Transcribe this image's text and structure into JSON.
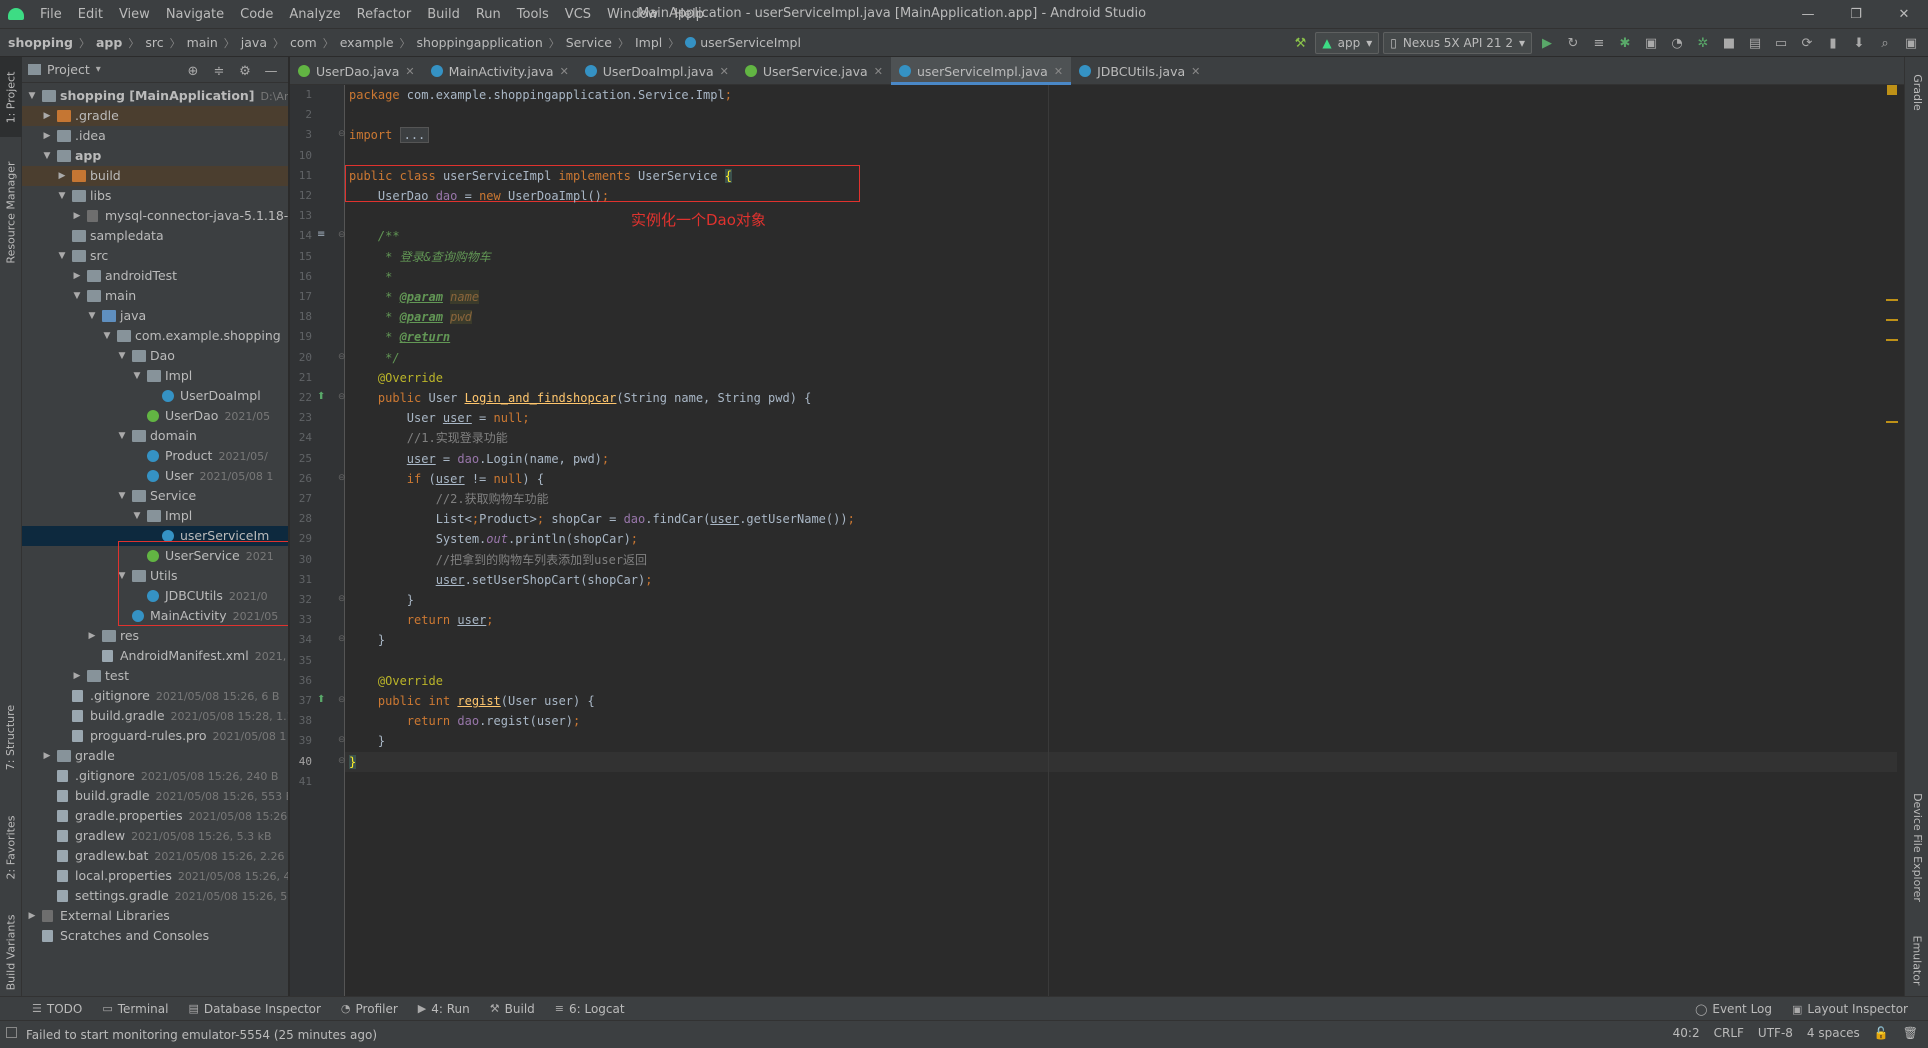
{
  "window": {
    "title": "MainApplication - userServiceImpl.java [MainApplication.app] - Android Studio",
    "menu": [
      "File",
      "Edit",
      "View",
      "Navigate",
      "Code",
      "Analyze",
      "Refactor",
      "Build",
      "Run",
      "Tools",
      "VCS",
      "Window",
      "Help"
    ]
  },
  "breadcrumbs": [
    "shopping",
    "app",
    "src",
    "main",
    "java",
    "com",
    "example",
    "shoppingapplication",
    "Service",
    "Impl",
    "userServiceImpl"
  ],
  "toolbar": {
    "config": "app",
    "device": "Nexus 5X API 21 2"
  },
  "side_tabs": {
    "project": "1: Project",
    "resource_manager": "Resource Manager",
    "structure": "7: Structure",
    "favorites": "2: Favorites",
    "build_variants": "Build Variants",
    "gradle": "Gradle",
    "device_file_explorer": "Device File Explorer",
    "emulator": "Emulator"
  },
  "project_panel": {
    "title": "Project",
    "tree": [
      {
        "label": "shopping [MainApplication]",
        "meta": "D:\\Andro",
        "depth": 0,
        "icon": "folder",
        "arrow": "open",
        "bold": true
      },
      {
        "label": ".gradle",
        "meta": "",
        "depth": 1,
        "icon": "folder-orange",
        "arrow": "closed",
        "hl": true
      },
      {
        "label": ".idea",
        "meta": "",
        "depth": 1,
        "icon": "folder",
        "arrow": "closed"
      },
      {
        "label": "app",
        "meta": "",
        "depth": 1,
        "icon": "folder",
        "arrow": "open",
        "bold": true
      },
      {
        "label": "build",
        "meta": "",
        "depth": 2,
        "icon": "folder-orange",
        "arrow": "closed",
        "hl": true
      },
      {
        "label": "libs",
        "meta": "",
        "depth": 2,
        "icon": "folder",
        "arrow": "open"
      },
      {
        "label": "mysql-connector-java-5.1.18-l",
        "meta": "",
        "depth": 3,
        "icon": "lib",
        "arrow": "closed"
      },
      {
        "label": "sampledata",
        "meta": "",
        "depth": 2,
        "icon": "folder",
        "arrow": "none"
      },
      {
        "label": "src",
        "meta": "",
        "depth": 2,
        "icon": "folder",
        "arrow": "open"
      },
      {
        "label": "androidTest",
        "meta": "",
        "depth": 3,
        "icon": "folder",
        "arrow": "closed"
      },
      {
        "label": "main",
        "meta": "",
        "depth": 3,
        "icon": "folder",
        "arrow": "open"
      },
      {
        "label": "java",
        "meta": "",
        "depth": 4,
        "icon": "folder-blue",
        "arrow": "open"
      },
      {
        "label": "com.example.shopping",
        "meta": "",
        "depth": 5,
        "icon": "pkg",
        "arrow": "open"
      },
      {
        "label": "Dao",
        "meta": "",
        "depth": 6,
        "icon": "pkg",
        "arrow": "open"
      },
      {
        "label": "Impl",
        "meta": "",
        "depth": 7,
        "icon": "pkg",
        "arrow": "open"
      },
      {
        "label": "UserDoaImpl",
        "meta": "",
        "depth": 8,
        "icon": "cls",
        "arrow": "none"
      },
      {
        "label": "UserDao",
        "meta": "2021/05",
        "depth": 7,
        "icon": "iface",
        "arrow": "none"
      },
      {
        "label": "domain",
        "meta": "",
        "depth": 6,
        "icon": "pkg",
        "arrow": "open"
      },
      {
        "label": "Product",
        "meta": "2021/05/",
        "depth": 7,
        "icon": "cls",
        "arrow": "none"
      },
      {
        "label": "User",
        "meta": "2021/05/08 1",
        "depth": 7,
        "icon": "cls",
        "arrow": "none"
      },
      {
        "label": "Service",
        "meta": "",
        "depth": 6,
        "icon": "pkg",
        "arrow": "open"
      },
      {
        "label": "Impl",
        "meta": "",
        "depth": 7,
        "icon": "pkg",
        "arrow": "open"
      },
      {
        "label": "userServiceIm",
        "meta": "",
        "depth": 8,
        "icon": "cls",
        "arrow": "none",
        "sel": true
      },
      {
        "label": "UserService",
        "meta": "2021",
        "depth": 7,
        "icon": "iface",
        "arrow": "none"
      },
      {
        "label": "Utils",
        "meta": "",
        "depth": 6,
        "icon": "pkg",
        "arrow": "open"
      },
      {
        "label": "JDBCUtils",
        "meta": "2021/0",
        "depth": 7,
        "icon": "cls",
        "arrow": "none"
      },
      {
        "label": "MainActivity",
        "meta": "2021/05",
        "depth": 6,
        "icon": "cls",
        "arrow": "none"
      },
      {
        "label": "res",
        "meta": "",
        "depth": 4,
        "icon": "folder",
        "arrow": "closed"
      },
      {
        "label": "AndroidManifest.xml",
        "meta": "2021,",
        "depth": 4,
        "icon": "file",
        "arrow": "none"
      },
      {
        "label": "test",
        "meta": "",
        "depth": 3,
        "icon": "folder",
        "arrow": "closed"
      },
      {
        "label": ".gitignore",
        "meta": "2021/05/08 15:26, 6 B",
        "depth": 2,
        "icon": "file",
        "arrow": "none"
      },
      {
        "label": "build.gradle",
        "meta": "2021/05/08 15:28, 1.1",
        "depth": 2,
        "icon": "file",
        "arrow": "none"
      },
      {
        "label": "proguard-rules.pro",
        "meta": "2021/05/08 1",
        "depth": 2,
        "icon": "file",
        "arrow": "none"
      },
      {
        "label": "gradle",
        "meta": "",
        "depth": 1,
        "icon": "folder",
        "arrow": "closed"
      },
      {
        "label": ".gitignore",
        "meta": "2021/05/08 15:26, 240 B",
        "depth": 1,
        "icon": "file",
        "arrow": "none"
      },
      {
        "label": "build.gradle",
        "meta": "2021/05/08 15:26, 553 B",
        "depth": 1,
        "icon": "file",
        "arrow": "none"
      },
      {
        "label": "gradle.properties",
        "meta": "2021/05/08 15:26, 1",
        "depth": 1,
        "icon": "file",
        "arrow": "none"
      },
      {
        "label": "gradlew",
        "meta": "2021/05/08 15:26, 5.3 kB",
        "depth": 1,
        "icon": "file",
        "arrow": "none"
      },
      {
        "label": "gradlew.bat",
        "meta": "2021/05/08 15:26, 2.26 kB",
        "depth": 1,
        "icon": "file",
        "arrow": "none"
      },
      {
        "label": "local.properties",
        "meta": "2021/05/08 15:26, 42",
        "depth": 1,
        "icon": "file",
        "arrow": "none"
      },
      {
        "label": "settings.gradle",
        "meta": "2021/05/08 15:26, 52 B",
        "depth": 1,
        "icon": "file",
        "arrow": "none"
      },
      {
        "label": "External Libraries",
        "meta": "",
        "depth": 0,
        "icon": "lib",
        "arrow": "closed"
      },
      {
        "label": "Scratches and Consoles",
        "meta": "",
        "depth": 0,
        "icon": "file",
        "arrow": "none"
      }
    ]
  },
  "editor_tabs": [
    {
      "label": "UserDao.java",
      "kind": "iface",
      "active": false
    },
    {
      "label": "MainActivity.java",
      "kind": "cls",
      "active": false
    },
    {
      "label": "UserDoaImpl.java",
      "kind": "cls",
      "active": false
    },
    {
      "label": "UserService.java",
      "kind": "iface",
      "active": false
    },
    {
      "label": "userServiceImpl.java",
      "kind": "cls",
      "active": true
    },
    {
      "label": "JDBCUtils.java",
      "kind": "cls",
      "active": false
    }
  ],
  "annotation_note": "实例化一个Dao对象",
  "code": {
    "line_numbers": [
      "1",
      "2",
      "3",
      "10",
      "11",
      "12",
      "13",
      "14",
      "15",
      "16",
      "17",
      "18",
      "19",
      "20",
      "21",
      "22",
      "23",
      "24",
      "25",
      "26",
      "27",
      "28",
      "29",
      "30",
      "31",
      "32",
      "33",
      "34",
      "35",
      "36",
      "37",
      "38",
      "39",
      "40",
      "41"
    ],
    "current_line": "40",
    "lines": [
      "package com.example.shoppingapplication.Service.Impl;",
      "",
      "import ...",
      "",
      "public class userServiceImpl implements UserService {",
      "    UserDao dao = new UserDoaImpl();",
      "",
      "    /**",
      "     * 登录&查询购物车",
      "     *",
      "     * @param name",
      "     * @param pwd",
      "     * @return",
      "     */",
      "    @Override",
      "    public User Login_and_findshopcar(String name, String pwd) {",
      "        User user = null;",
      "        //1.实现登录功能",
      "        user = dao.Login(name, pwd);",
      "        if (user != null) {",
      "            //2.获取购物车功能",
      "            List<Product> shopCar = dao.findCar(user.getUserName());",
      "            System.out.println(shopCar);",
      "            //把拿到的购物车列表添加到user返回",
      "            user.setUserShopCart(shopCar);",
      "        }",
      "        return user;",
      "    }",
      "",
      "    @Override",
      "    public int regist(User user) {",
      "        return dao.regist(user);",
      "    }",
      "}",
      ""
    ]
  },
  "bottom_tools": [
    "TODO",
    "Terminal",
    "Database Inspector",
    "Profiler",
    "4: Run",
    "Build",
    "6: Logcat"
  ],
  "bottom_right_tools": [
    "Event Log",
    "Layout Inspector"
  ],
  "status": {
    "message": "Failed to start monitoring emulator-5554 (25 minutes ago)",
    "position": "40:2",
    "line_sep": "CRLF",
    "encoding": "UTF-8",
    "indent": "4 spaces"
  },
  "colors": {
    "accent": "#4a88c7",
    "annotation_red": "#e0322e",
    "keyword": "#cc7832",
    "doc_comment": "#629755"
  }
}
